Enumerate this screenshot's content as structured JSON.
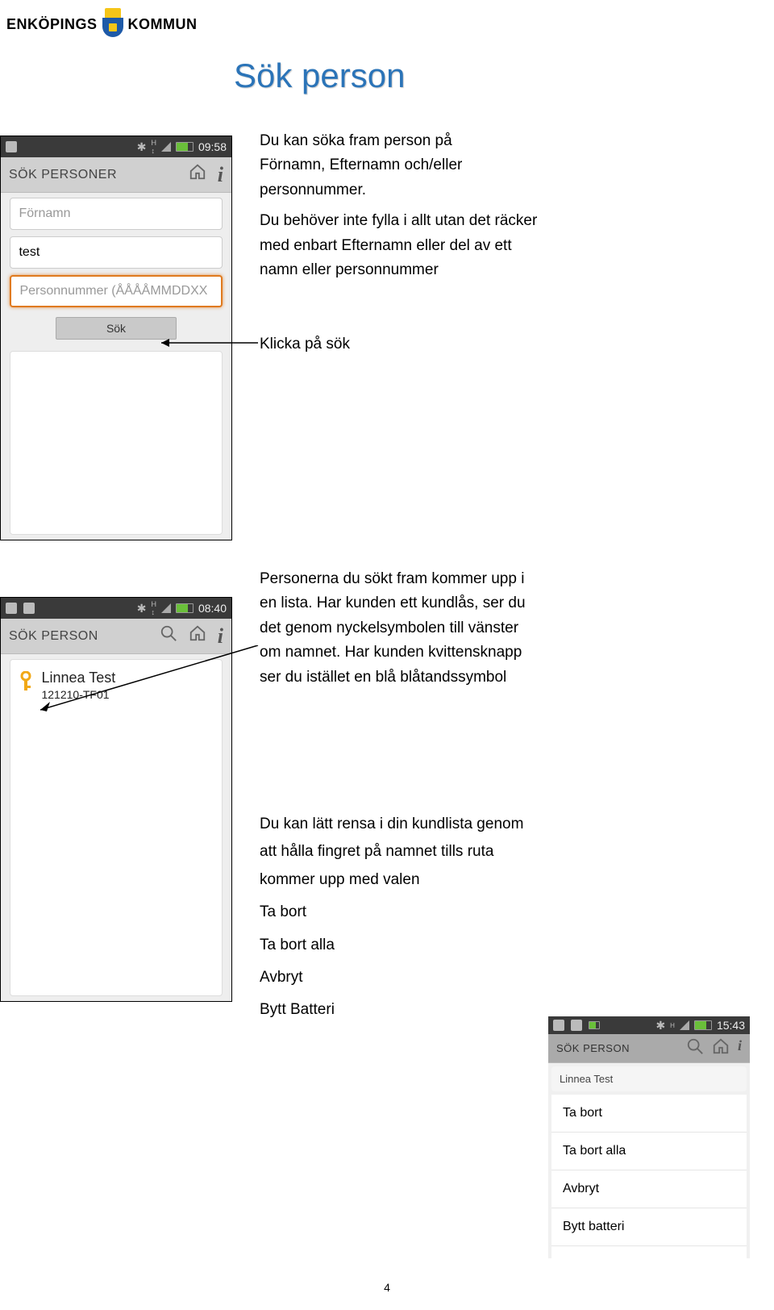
{
  "logo": {
    "left": "ENKÖPINGS",
    "right": "KOMMUN"
  },
  "page_title": "Sök person",
  "phone1": {
    "time": "09:58",
    "appbar_title": "SÖK PERSONER",
    "input_fornamn_placeholder": "Förnamn",
    "input_efternamn_value": "test",
    "input_pnr_placeholder": "Personnummer (ÅÅÅÅMMDDXX",
    "search_button": "Sök"
  },
  "phone2": {
    "time": "08:40",
    "appbar_title": "SÖK PERSON",
    "row_name": "Linnea Test",
    "row_sub": "121210-TF01"
  },
  "phone3": {
    "time": "15:43",
    "appbar_title": "SÖK PERSON",
    "dim_name": "Linnea Test",
    "menu": {
      "ta_bort": "Ta bort",
      "ta_bort_alla": "Ta bort alla",
      "avbryt": "Avbryt",
      "bytt_batteri": "Bytt batteri"
    }
  },
  "desc1": {
    "l1": "Du kan söka fram person på",
    "l2": "Förnamn, Efternamn och/eller",
    "l3": "personnummer.",
    "l4": "Du behöver inte fylla i allt utan det räcker",
    "l5": "med enbart Efternamn eller del av ett",
    "l6": "namn eller personnummer"
  },
  "desc2": "Klicka på sök",
  "desc3": {
    "l1": "Personerna du sökt fram kommer upp i",
    "l2": "en lista. Har kunden ett kundlås, ser du",
    "l3": "det genom nyckelsymbolen till vänster",
    "l4": "om namnet. Har kunden kvittensknapp",
    "l5": "ser du istället en blå blåtandssymbol"
  },
  "desc4": {
    "l1": "Du kan lätt rensa i din kundlista genom",
    "l2": "att hålla fingret på namnet tills ruta",
    "l3": "kommer upp med valen",
    "opt1": "Ta bort",
    "opt2": "Ta bort alla",
    "opt3": "Avbryt",
    "opt4": "Bytt Batteri"
  },
  "page_number": "4"
}
